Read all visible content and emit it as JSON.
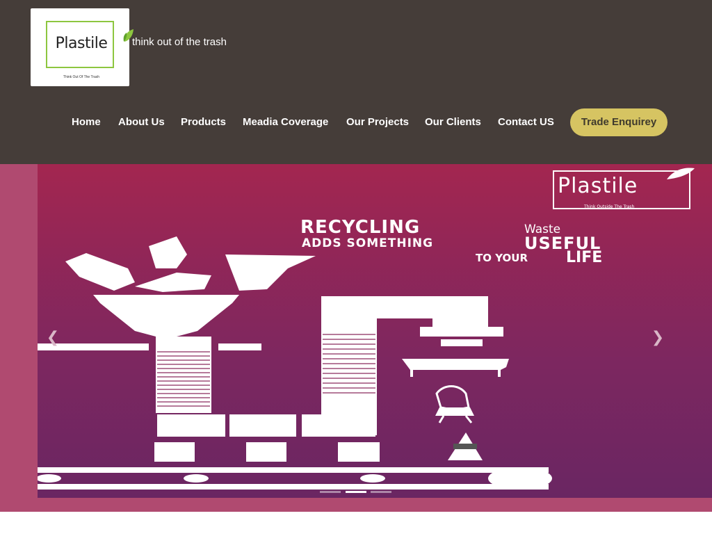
{
  "header": {
    "logo": {
      "word": "Plastile",
      "sub": "Think Out Of The Trash"
    },
    "tagline": "think out of the trash",
    "nav": [
      {
        "label": "Home"
      },
      {
        "label": "About Us"
      },
      {
        "label": "Products"
      },
      {
        "label": "Meadia Coverage"
      },
      {
        "label": "Our Projects"
      },
      {
        "label": "Our Clients"
      },
      {
        "label": "Contact US"
      }
    ],
    "cta": "Trade Enquirey"
  },
  "slider": {
    "brand": {
      "word": "Plastile",
      "sub": "Think Outside The Trash"
    },
    "headline": {
      "line1a": "RECYCLING",
      "line1b": "Waste",
      "line2a": "ADDS SOMETHING",
      "line2b": "USEFUL",
      "line3a": "TO YOUR",
      "line3b": "LIFE"
    },
    "prev_icon": "chevron-left-icon",
    "next_icon": "chevron-right-icon",
    "prev_glyph": "❮",
    "next_glyph": "❯",
    "active_slide": 2,
    "slide_count": 3
  },
  "colors": {
    "header_bg": "#453d39",
    "cta_bg": "#d6c462",
    "slide_top": "#a32650",
    "slide_bottom": "#6a2662",
    "logo_green": "#8dc63f"
  }
}
